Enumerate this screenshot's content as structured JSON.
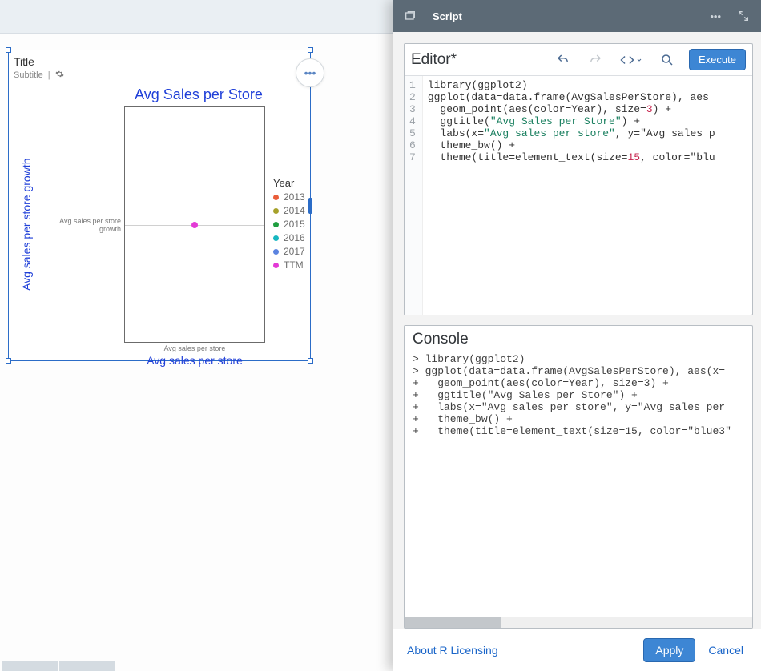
{
  "card": {
    "title": "Title",
    "subtitle": "Subtitle",
    "subtitle_icon": "settings-icon"
  },
  "chart_data": {
    "type": "scatter",
    "title": "Avg Sales per Store",
    "xlabel": "Avg sales per store",
    "ylabel": "Avg sales per store growth",
    "x_tick": "Avg sales per store",
    "y_tick": "Avg sales per store growth",
    "legend_title": "Year",
    "series": [
      {
        "name": "2013",
        "color": "#ea5d3a"
      },
      {
        "name": "2014",
        "color": "#a6a12a"
      },
      {
        "name": "2015",
        "color": "#1f9e40"
      },
      {
        "name": "2016",
        "color": "#17b7c0"
      },
      {
        "name": "2017",
        "color": "#5b83e0"
      },
      {
        "name": "TTM",
        "color": "#e33ad6"
      }
    ],
    "visible_point_color": "#e33ad6"
  },
  "script_panel": {
    "header_title": "Script",
    "editor_label": "Editor*",
    "execute_label": "Execute",
    "code_lines": [
      "library(ggplot2)",
      "ggplot(data=data.frame(AvgSalesPerStore), aes",
      "  geom_point(aes(color=Year), size=3) +",
      "  ggtitle(\"Avg Sales per Store\") +",
      "  labs(x=\"Avg sales per store\", y=\"Avg sales p",
      "  theme_bw() +",
      "  theme(title=element_text(size=15, color=\"blu"
    ],
    "console_label": "Console",
    "console_lines": [
      "> library(ggplot2)",
      "> ggplot(data=data.frame(AvgSalesPerStore), aes(x=",
      "+   geom_point(aes(color=Year), size=3) +",
      "+   ggtitle(\"Avg Sales per Store\") +",
      "+   labs(x=\"Avg sales per store\", y=\"Avg sales per",
      "+   theme_bw() +",
      "+   theme(title=element_text(size=15, color=\"blue3\""
    ]
  },
  "footer": {
    "about": "About R Licensing",
    "apply": "Apply",
    "cancel": "Cancel"
  }
}
